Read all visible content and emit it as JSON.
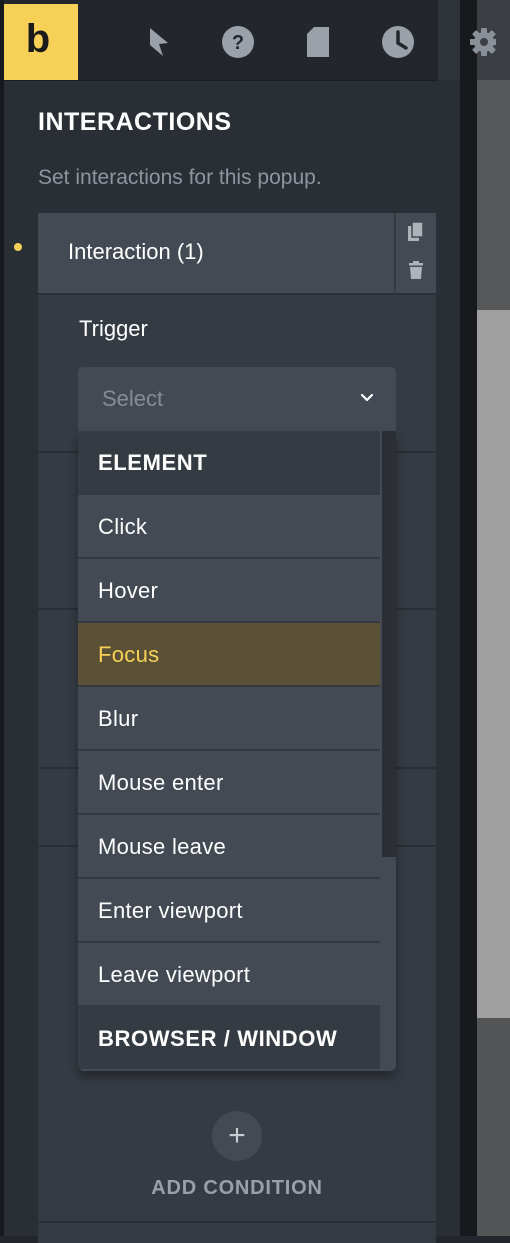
{
  "brand": {
    "logo_letter": "b",
    "accent": "#f7d157"
  },
  "toolbar": {
    "icons": [
      "pointer-icon",
      "help-icon",
      "page-icon",
      "history-icon",
      "settings-gear-icon"
    ]
  },
  "panel": {
    "title": "INTERACTIONS",
    "subtitle": "Set interactions for this popup."
  },
  "interaction": {
    "label": "Interaction (1)",
    "actions": [
      "copy-icon",
      "delete-icon"
    ]
  },
  "trigger": {
    "label": "Trigger",
    "placeholder": "Select",
    "options": [
      {
        "label": "ELEMENT",
        "group": true
      },
      {
        "label": "Click"
      },
      {
        "label": "Hover"
      },
      {
        "label": "Focus",
        "highlighted": true
      },
      {
        "label": "Blur"
      },
      {
        "label": "Mouse enter"
      },
      {
        "label": "Mouse leave"
      },
      {
        "label": "Enter viewport"
      },
      {
        "label": "Leave viewport"
      },
      {
        "label": "BROWSER / WINDOW",
        "group": true
      }
    ]
  },
  "add_condition": {
    "icon": "+",
    "label": "ADD CONDITION"
  }
}
